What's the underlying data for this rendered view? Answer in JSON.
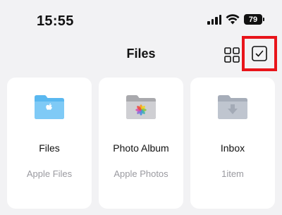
{
  "status_bar": {
    "time": "15:55",
    "battery": "79",
    "icons": [
      "signal-icon",
      "wifi-icon",
      "battery-icon"
    ]
  },
  "nav": {
    "title": "Files",
    "grid_icon": "grid-icon",
    "select_icon": "checkbox-icon",
    "highlight_color": "#e8141a"
  },
  "cards": [
    {
      "title": "Files",
      "subtitle": "Apple Files",
      "icon": "apple-folder-icon",
      "folder_color": "#5ab8f0"
    },
    {
      "title": "Photo Album",
      "subtitle": "Apple Photos",
      "icon": "photos-folder-icon",
      "folder_color": "#b9b9bd"
    },
    {
      "title": "Inbox",
      "subtitle": "1item",
      "icon": "inbox-folder-icon",
      "folder_color": "#b3b9c4"
    }
  ]
}
